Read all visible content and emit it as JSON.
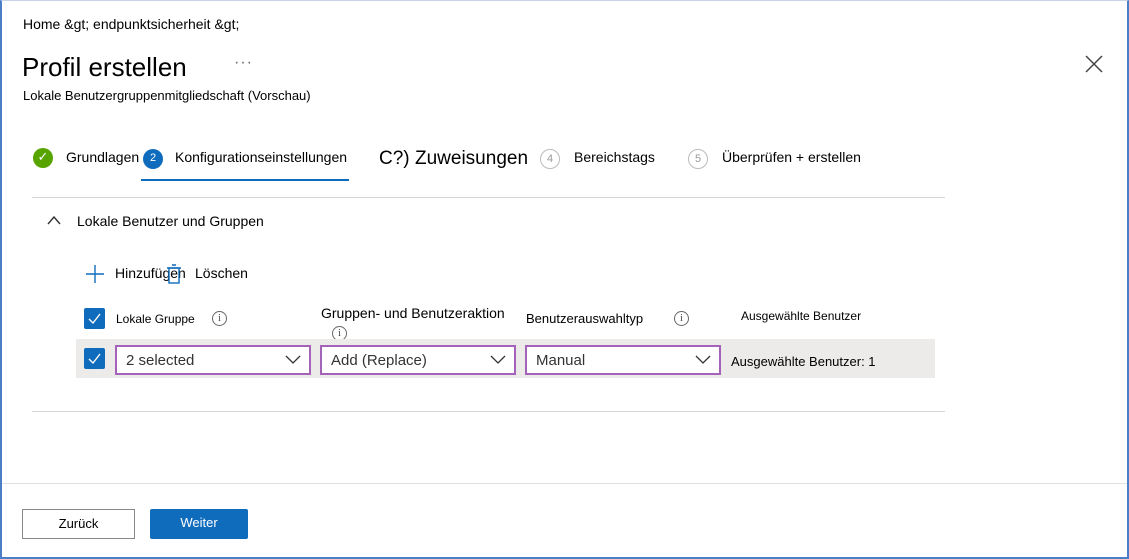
{
  "breadcrumb": "Home &gt;  endpunktsicherheit &gt;",
  "header": {
    "title": "Profil erstellen",
    "more": "···",
    "subtitle": "Lokale Benutzergruppenmitgliedschaft (Vorschau)"
  },
  "steps": [
    {
      "num": "✓",
      "label": "Grundlagen",
      "state": "done"
    },
    {
      "num": "2",
      "label": "Konfigurationseinstellungen",
      "state": "active"
    },
    {
      "num": "C?)",
      "label": "Zuweisungen",
      "state": "pending"
    },
    {
      "num": "4",
      "label": "Bereichstags",
      "state": "pending"
    },
    {
      "num": "5",
      "label": "Überprüfen + erstellen",
      "state": "pending"
    }
  ],
  "section": {
    "title": "Lokale Benutzer und Gruppen"
  },
  "toolbar": {
    "add": "Hinzufügen",
    "delete": "Löschen"
  },
  "table": {
    "headers": [
      "Lokale Gruppe",
      "Gruppen- und Benutzeraktion",
      "Benutzerauswahltyp",
      "Ausgewählte Benutzer"
    ],
    "row": {
      "group": "2 selected",
      "action": "Add (Replace)",
      "type": "Manual",
      "users": "Ausgewählte Benutzer: 1"
    }
  },
  "footer": {
    "back": "Zurück",
    "next": "Weiter"
  },
  "colors": {
    "accent": "#0f6cbd",
    "success": "#57a300",
    "dropdown_border": "#a463b9"
  }
}
